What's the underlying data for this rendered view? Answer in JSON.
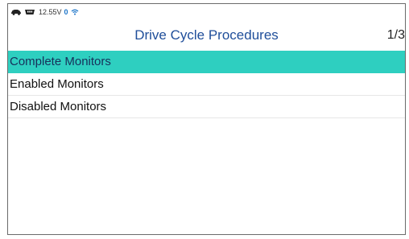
{
  "status": {
    "icons": [
      "car-icon",
      "obd-connector-icon",
      "wifi-icon"
    ],
    "voltage": "12.55V",
    "count": "0"
  },
  "header": {
    "title": "Drive Cycle Procedures",
    "page": "1/3"
  },
  "menu": {
    "items": [
      {
        "label": "Complete Monitors",
        "selected": true
      },
      {
        "label": "Enabled Monitors",
        "selected": false
      },
      {
        "label": "Disabled Monitors",
        "selected": false
      }
    ]
  },
  "colors": {
    "accent": "#2ecfc0",
    "title": "#1f4e9a",
    "status_count": "#1a73c8"
  }
}
